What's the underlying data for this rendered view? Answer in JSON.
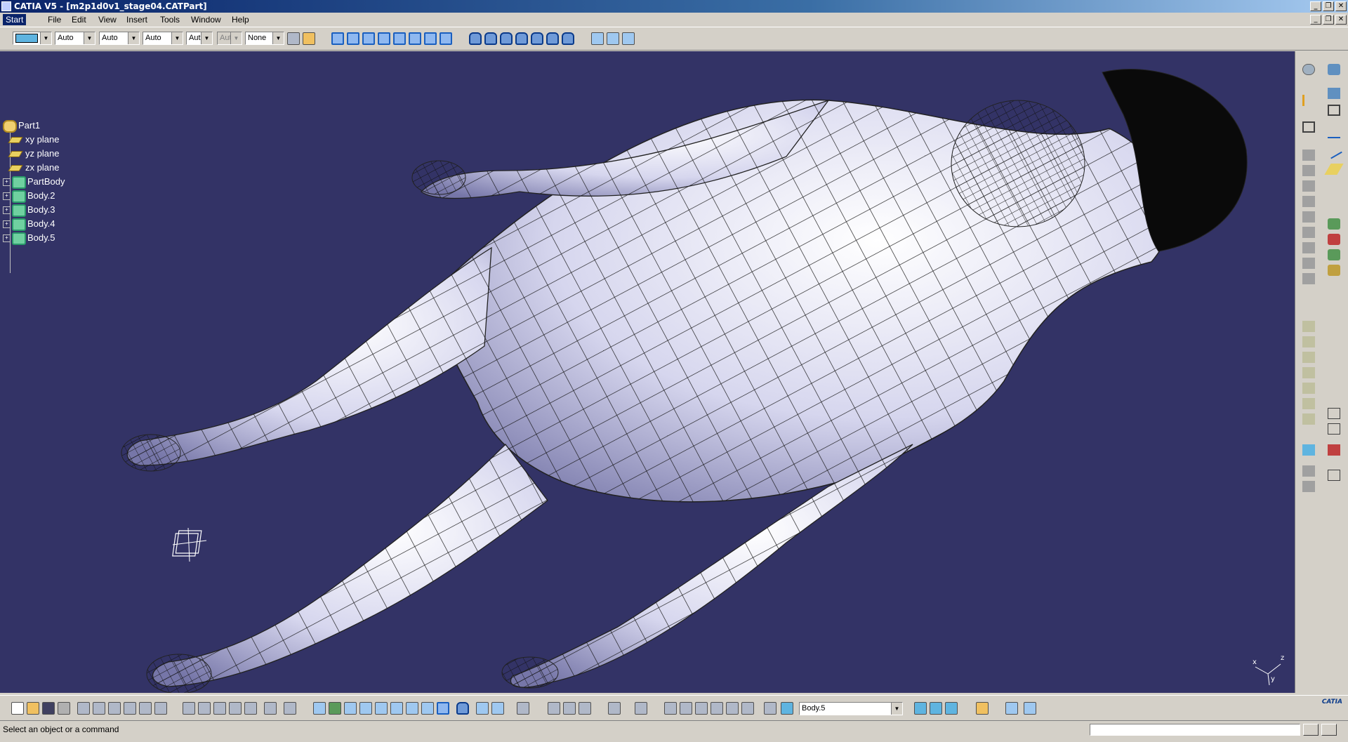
{
  "window": {
    "title": "CATIA V5 - [m2p1d0v1_stage04.CATPart]"
  },
  "menu": {
    "items": [
      "Start",
      "File",
      "Edit",
      "View",
      "Insert",
      "Tools",
      "Window",
      "Help"
    ]
  },
  "toolbar_top": {
    "color_combo": "",
    "line_type": "Auto",
    "thickness": "Auto",
    "point_type": "Auto",
    "layer_short": "Aut",
    "transparency": "Aut",
    "render_style": "None"
  },
  "tree": {
    "root": "Part1",
    "items": [
      "xy plane",
      "yz plane",
      "zx plane",
      "PartBody",
      "Body.2",
      "Body.3",
      "Body.4",
      "Body.5"
    ]
  },
  "axis": {
    "x": "x",
    "z": "z",
    "y": "y"
  },
  "toolbar_bottom": {
    "current_body": "Body.5",
    "brand": "CATIA"
  },
  "status": {
    "message": "Select an object or a command"
  },
  "colors": {
    "viewport_bg": "#333366",
    "model_surface": "#e8e8f4",
    "mesh_lines": "#111111",
    "hair": "#0a0a0a"
  }
}
